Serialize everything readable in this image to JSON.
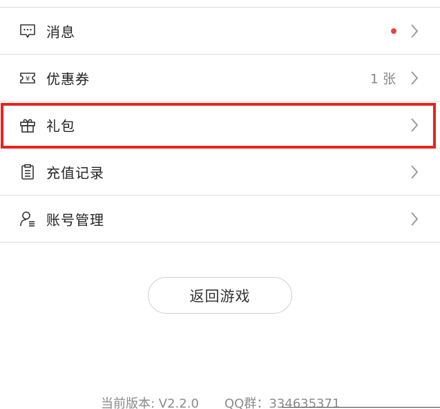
{
  "menu": {
    "items": [
      {
        "label": "消息",
        "right_text": null,
        "has_dot": true,
        "icon": "message-icon"
      },
      {
        "label": "优惠券",
        "right_text": "1 张",
        "has_dot": false,
        "icon": "coupon-icon"
      },
      {
        "label": "礼包",
        "right_text": null,
        "has_dot": false,
        "icon": "gift-icon",
        "highlighted": true
      },
      {
        "label": "充值记录",
        "right_text": null,
        "has_dot": false,
        "icon": "clipboard-icon"
      },
      {
        "label": "账号管理",
        "right_text": null,
        "has_dot": false,
        "icon": "user-manage-icon"
      }
    ]
  },
  "return_button": {
    "label": "返回游戏"
  },
  "footer": {
    "version": "当前版本: V2.2.0",
    "qq_group": "QQ群：334635371"
  },
  "colors": {
    "highlight": "#e8221d",
    "dot": "#e8403a",
    "text": "#222222",
    "muted": "#888888"
  }
}
